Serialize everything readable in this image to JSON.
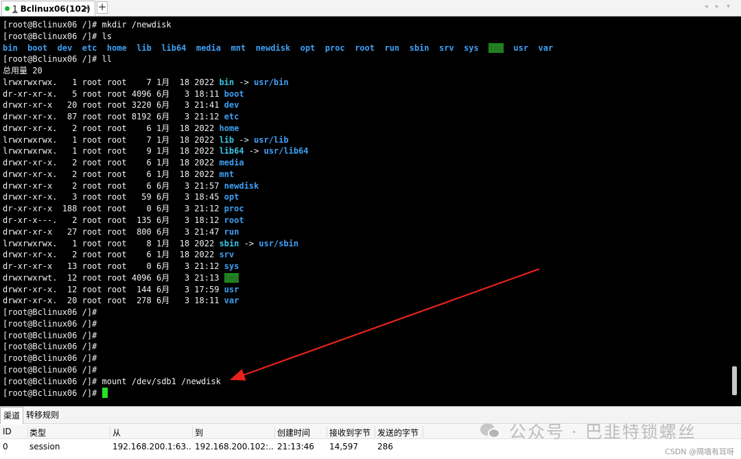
{
  "tabbar": {
    "tab_number": "1",
    "tab_title": "Bclinux06(102)",
    "new_tab_label": "+",
    "nav_arrows": "◂ ▸ ▾"
  },
  "terminal": {
    "prompt": "[root@Bclinux06 /]# ",
    "cmd_mkdir": "mkdir /newdisk",
    "cmd_ls": "ls",
    "ls_entries": [
      "bin",
      "boot",
      "dev",
      "etc",
      "home",
      "lib",
      "lib64",
      "media",
      "mnt",
      "newdisk",
      "opt",
      "proc",
      "root",
      "run",
      "sbin",
      "srv",
      "sys",
      "tmp",
      "usr",
      "var"
    ],
    "cmd_ll": "ll",
    "total_line": "总用量 20",
    "ll_rows": [
      {
        "meta": "lrwxrwxrwx.   1 root root    7 1月  18 2022 ",
        "name": "bin",
        "target": "usr/bin"
      },
      {
        "meta": "dr-xr-xr-x.   5 root root 4096 6月   3 18:11 ",
        "name": "boot"
      },
      {
        "meta": "drwxr-xr-x   20 root root 3220 6月   3 21:41 ",
        "name": "dev"
      },
      {
        "meta": "drwxr-xr-x.  87 root root 8192 6月   3 21:12 ",
        "name": "etc"
      },
      {
        "meta": "drwxr-xr-x.   2 root root    6 1月  18 2022 ",
        "name": "home"
      },
      {
        "meta": "lrwxrwxrwx.   1 root root    7 1月  18 2022 ",
        "name": "lib",
        "target": "usr/lib"
      },
      {
        "meta": "lrwxrwxrwx.   1 root root    9 1月  18 2022 ",
        "name": "lib64",
        "target": "usr/lib64"
      },
      {
        "meta": "drwxr-xr-x.   2 root root    6 1月  18 2022 ",
        "name": "media"
      },
      {
        "meta": "drwxr-xr-x.   2 root root    6 1月  18 2022 ",
        "name": "mnt"
      },
      {
        "meta": "drwxr-xr-x    2 root root    6 6月   3 21:57 ",
        "name": "newdisk"
      },
      {
        "meta": "drwxr-xr-x.   3 root root   59 6月   3 18:45 ",
        "name": "opt"
      },
      {
        "meta": "dr-xr-xr-x  188 root root    0 6月   3 21:12 ",
        "name": "proc"
      },
      {
        "meta": "dr-xr-x---.   2 root root  135 6月   3 18:12 ",
        "name": "root"
      },
      {
        "meta": "drwxr-xr-x   27 root root  800 6月   3 21:47 ",
        "name": "run"
      },
      {
        "meta": "lrwxrwxrwx.   1 root root    8 1月  18 2022 ",
        "name": "sbin",
        "target": "usr/sbin"
      },
      {
        "meta": "drwxr-xr-x.   2 root root    6 1月  18 2022 ",
        "name": "srv"
      },
      {
        "meta": "dr-xr-xr-x   13 root root    0 6月   3 21:12 ",
        "name": "sys"
      },
      {
        "meta": "drwxrwxrwt.  12 root root 4096 6月   3 21:13 ",
        "name": "tmp",
        "tmp": true
      },
      {
        "meta": "drwxr-xr-x.  12 root root  144 6月   3 17:59 ",
        "name": "usr"
      },
      {
        "meta": "drwxr-xr-x.  20 root root  278 6月   3 18:11 ",
        "name": "var"
      }
    ],
    "link_arrow": " -> ",
    "empty_prompt_count": 6,
    "cmd_mount": "mount /dev/sdb1 /newdisk"
  },
  "panel": {
    "tabs": [
      "渠道",
      "转移规则"
    ],
    "headers": [
      "ID",
      "类型",
      "从",
      "到",
      "创建时间",
      "接收到字节",
      "发送的字节"
    ],
    "row": [
      "0",
      "session",
      "192.168.200.1:63...",
      "192.168.200.102:...",
      "21:13:46",
      "14,597",
      "286"
    ]
  },
  "watermark": {
    "text": "公众号 · 巴韭特锁螺丝",
    "credit": "CSDN @隔墙有耳呀"
  },
  "colors": {
    "dir": "#3ea0f5",
    "link": "#39c6e8",
    "cursor": "#27e227",
    "arrow": "#e8231d"
  }
}
